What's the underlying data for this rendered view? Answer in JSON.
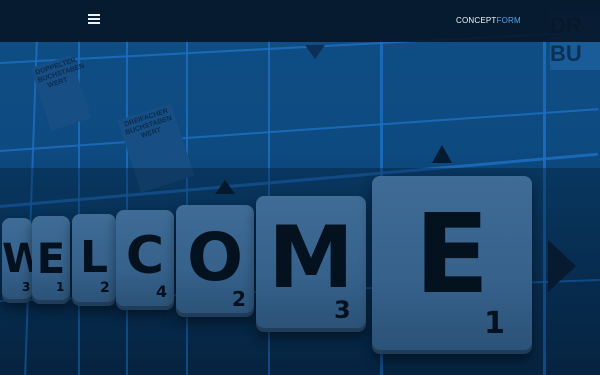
{
  "header": {
    "brand_part1": "CONCEPT",
    "brand_part2": "FORM",
    "brand_color": "#4ea3ec"
  },
  "menu": {
    "icon": "hamburger-menu-icon"
  },
  "hero": {
    "board_labels": [
      {
        "text": "DOPPELTER\nBUCHSTABEN\nWERT"
      },
      {
        "text": "DREIFACHER\nBUCHSTABEN\nWERT"
      }
    ],
    "corner_text": "DR\nBU",
    "tiles": [
      {
        "letter": "W",
        "score": "3"
      },
      {
        "letter": "E",
        "score": "1"
      },
      {
        "letter": "L",
        "score": "2"
      },
      {
        "letter": "C",
        "score": "4"
      },
      {
        "letter": "O",
        "score": "2"
      },
      {
        "letter": "M",
        "score": "3"
      },
      {
        "letter": "E",
        "score": "1"
      }
    ]
  },
  "colors": {
    "overlay": "#0d4a80",
    "header_bg": "#061424",
    "grid_line": "#1d6fc0"
  }
}
